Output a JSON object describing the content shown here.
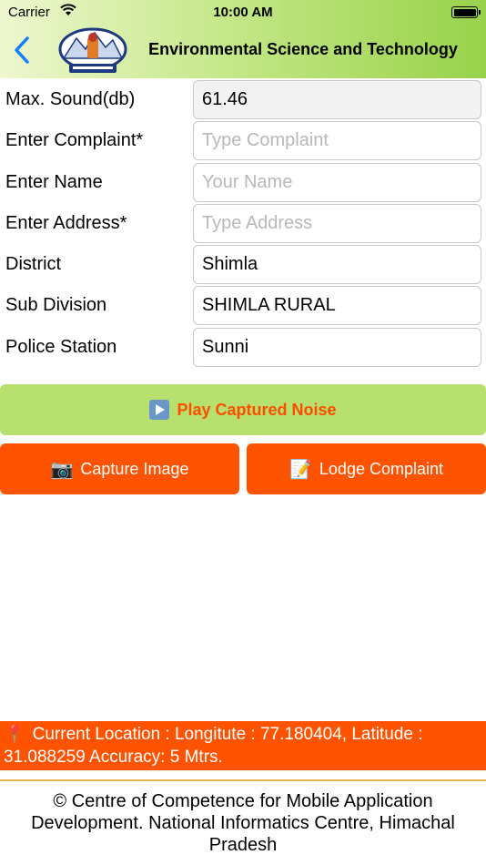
{
  "status": {
    "carrier": "Carrier",
    "time": "10:00 AM"
  },
  "header": {
    "title": "Environmental Science and Technology",
    "logo_icon": "state-emblem-icon",
    "back_icon": "chevron-left-icon"
  },
  "form": {
    "sound_label": "Max. Sound(db)",
    "sound_value": "61.46",
    "complaint_label": "Enter Complaint*",
    "complaint_placeholder": "Type Complaint",
    "name_label": "Enter Name",
    "name_placeholder": "Your Name",
    "address_label": "Enter Address*",
    "address_placeholder": "Type Address",
    "district_label": "District",
    "district_value": "Shimla",
    "subdivision_label": "Sub Division",
    "subdivision_value": "SHIMLA RURAL",
    "police_label": "Police Station",
    "police_value": "Sunni"
  },
  "actions": {
    "play_label": "Play Captured Noise",
    "capture_label": "Capture Image",
    "lodge_label": "Lodge Complaint"
  },
  "location": {
    "text": "Current Location : Longitute : 77.180404, Latitude : 31.088259 Accuracy: 5 Mtrs."
  },
  "footer": {
    "text": "© Centre of Competence for Mobile Application Development. National Informatics Centre, Himachal Pradesh"
  },
  "colors": {
    "accent_orange": "#ff5300",
    "play_green": "#b7e06e",
    "header_green": "#98d24a",
    "back_blue": "#147efb"
  }
}
